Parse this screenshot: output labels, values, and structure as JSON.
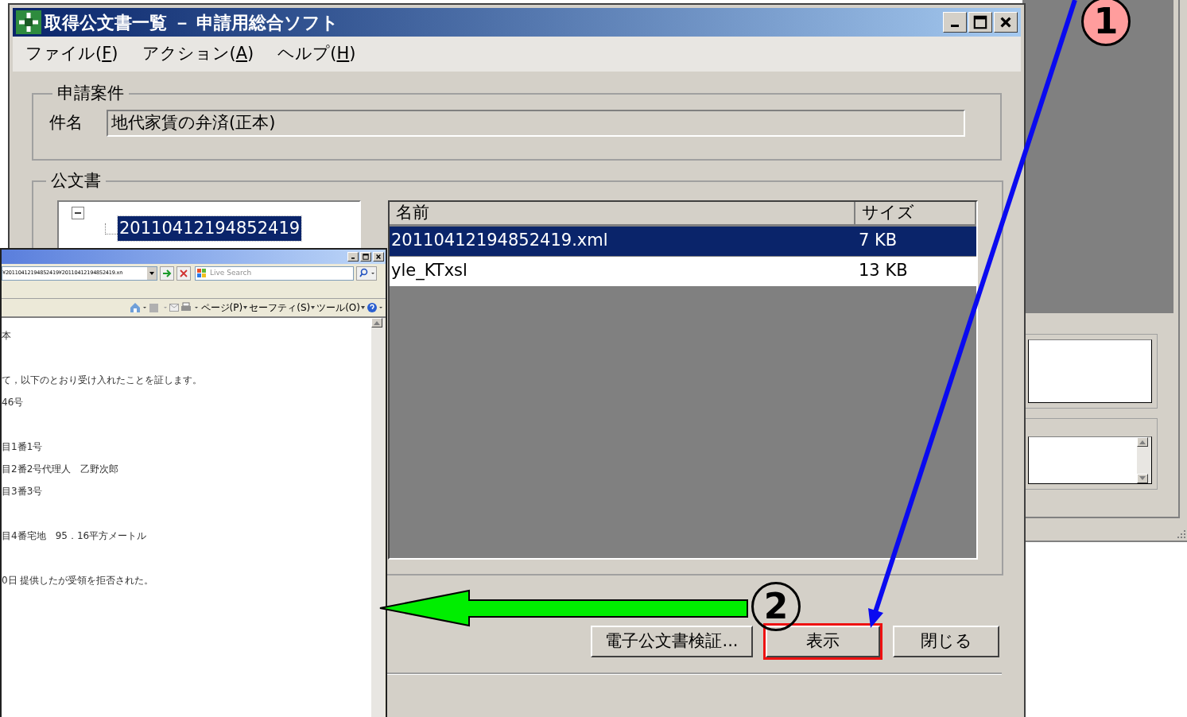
{
  "main_window": {
    "title": "取得公文書一覧 － 申請用総合ソフト",
    "menu": [
      {
        "text": "ファイル(",
        "key": "F",
        "close": ")"
      },
      {
        "text": "アクション(",
        "key": "A",
        "close": ")"
      },
      {
        "text": "ヘルプ(",
        "key": "H",
        "close": ")"
      }
    ],
    "application_group": {
      "legend": "申請案件",
      "field_label": "件名",
      "field_value": "地代家賃の弁済(正本)"
    },
    "documents_group": {
      "legend": "公文書",
      "tree": [
        {
          "label": "20110412194852419",
          "expanded": true,
          "selected": true
        }
      ],
      "file_list": {
        "columns": [
          "名前",
          "サイズ"
        ],
        "rows": [
          {
            "cells": [
              "20110412194852419.xml",
              "7 KB"
            ],
            "selected": true
          },
          {
            "cells": [
              "yle_KTxsl",
              "13 KB"
            ],
            "selected": false
          }
        ]
      }
    },
    "buttons": [
      {
        "label": "電子公文書検証...",
        "highlighted": false
      },
      {
        "label": "表示",
        "highlighted": true
      },
      {
        "label": "閉じる",
        "highlighted": false
      }
    ]
  },
  "browser_window": {
    "address": "¥20110412194852419¥20110412194852419.xn",
    "search_placeholder": "Live Search",
    "commands": [
      "ページ(P)",
      "セーフティ(S)",
      "ツール(O)"
    ],
    "content": [
      [
        "本"
      ],
      [
        "て，以下のとおり受け入れたことを証します。",
        "46号"
      ],
      [
        "目1番1号",
        "目2番2号代理人　乙野次郎",
        "目3番3号"
      ],
      [
        "目4番宅地　95．16平方メートル"
      ],
      [
        "0日 提供したが受領を拒否された。"
      ]
    ]
  },
  "step_markers": [
    {
      "label": "1",
      "filled": true
    },
    {
      "label": "2",
      "filled": false
    }
  ]
}
